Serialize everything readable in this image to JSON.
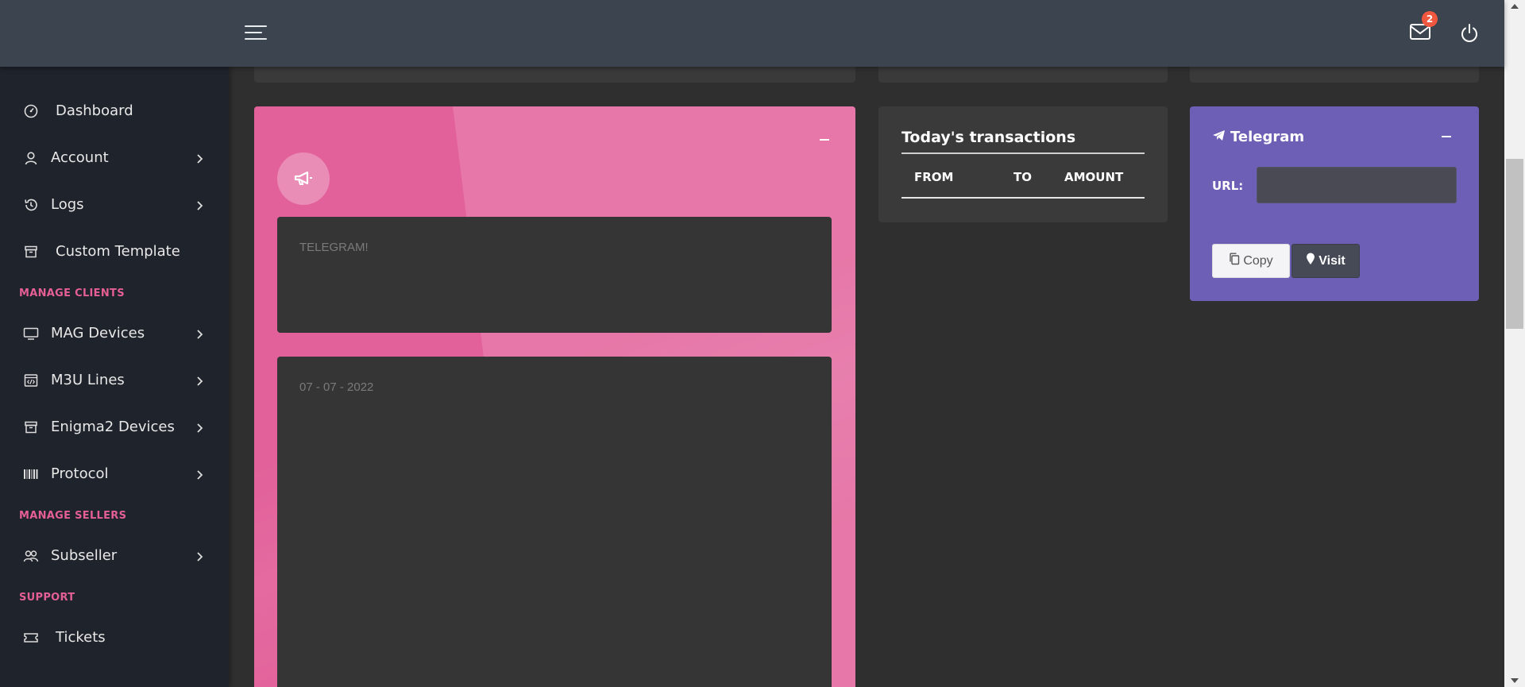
{
  "header": {
    "menu_icon": "hamburger-icon",
    "notifications": {
      "icon": "mail-icon",
      "count": "2"
    },
    "power_icon": "power-icon"
  },
  "sidebar": {
    "items": [
      {
        "label": "Dashboard",
        "icon": "speedometer-icon",
        "has_submenu": false
      },
      {
        "label": "Account",
        "icon": "user-icon",
        "has_submenu": true
      },
      {
        "label": "Logs",
        "icon": "history-icon",
        "has_submenu": true
      },
      {
        "label": "Custom Template",
        "icon": "archive-icon",
        "has_submenu": false
      }
    ],
    "section_manage_clients": "MANAGE CLIENTS",
    "clients_items": [
      {
        "label": "MAG Devices",
        "icon": "monitor-icon",
        "has_submenu": true
      },
      {
        "label": "M3U Lines",
        "icon": "code-window-icon",
        "has_submenu": true
      },
      {
        "label": "Enigma2 Devices",
        "icon": "archive-icon",
        "has_submenu": true
      },
      {
        "label": "Protocol",
        "icon": "barcode-icon",
        "has_submenu": true
      }
    ],
    "section_manage_sellers": "MANAGE SELLERS",
    "sellers_items": [
      {
        "label": "Subseller",
        "icon": "users-icon",
        "has_submenu": true
      }
    ],
    "section_support": "SUPPORT",
    "support_items": [
      {
        "label": "Tickets",
        "icon": "ticket-icon",
        "has_submenu": false
      }
    ]
  },
  "announcement": {
    "icon": "megaphone-icon",
    "title_box": "TELEGRAM!",
    "date_box": "07 - 07 - 2022",
    "accent": "#e2619a"
  },
  "transactions": {
    "title": "Today's transactions",
    "columns": [
      "FROM",
      "TO",
      "AMOUNT"
    ]
  },
  "telegram": {
    "title": "Telegram",
    "icon": "paper-plane-icon",
    "url_label": "URL:",
    "url_value": "",
    "copy_label": "Copy",
    "visit_label": "Visit",
    "accent": "#6c5fb5"
  }
}
